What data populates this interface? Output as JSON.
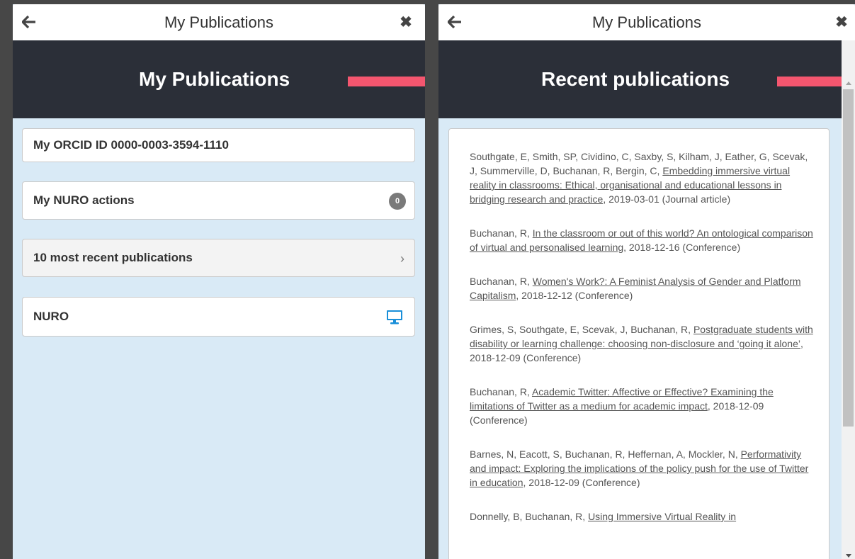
{
  "left_panel": {
    "window_title": "My Publications",
    "banner_title": "My Publications",
    "menu": {
      "orcid": "My ORCID ID 0000-0003-3594-1110",
      "actions": "My NURO actions",
      "actions_count": "0",
      "recent": "10 most recent publications",
      "nuro": "NURO"
    }
  },
  "right_panel": {
    "window_title": "My Publications",
    "banner_title": "Recent publications",
    "publications": [
      {
        "authors": "Southgate, E, Smith, SP, Cividino, C, Saxby, S, Kilham, J, Eather, G, Scevak, J, Summerville, D, Buchanan, R, Bergin, C, ",
        "title": "Embedding immersive virtual reality in classrooms: Ethical, organisational and educational lessons in bridging research and practice",
        "meta": ", 2019-03-01 (Journal article)"
      },
      {
        "authors": "Buchanan, R, ",
        "title": "In the classroom or out of this world? An ontological comparison of virtual and personalised learning",
        "meta": ", 2018-12-16 (Conference)"
      },
      {
        "authors": "Buchanan, R, ",
        "title": "Women's Work?: A Feminist Analysis of Gender and Platform Capitalism",
        "meta": ", 2018-12-12 (Conference)"
      },
      {
        "authors": "Grimes, S, Southgate, E, Scevak, J, Buchanan, R, ",
        "title": "Postgraduate students with disability or learning challenge: choosing non-disclosure and ‘going it alone’",
        "meta": ", 2018-12-09 (Conference)"
      },
      {
        "authors": "Buchanan, R, ",
        "title": "Academic Twitter: Affective or Effective? Examining the limitations of Twitter as a medium for academic impact",
        "meta": ", 2018-12-09 (Conference)"
      },
      {
        "authors": "Barnes, N, Eacott, S, Buchanan, R, Heffernan, A, Mockler, N, ",
        "title": "Performativity and impact: Exploring the implications of the policy push for the use of Twitter in education",
        "meta": ", 2018-12-09 (Conference)"
      },
      {
        "authors": "Donnelly, B, Buchanan, R, ",
        "title": "Using Immersive Virtual Reality in",
        "meta": ""
      }
    ]
  },
  "icons": {
    "back": "arrow-left-icon",
    "close": "close-icon",
    "badge": "count-badge",
    "chevron": "chevron-right-icon",
    "monitor": "desktop-monitor-icon"
  },
  "colors": {
    "banner_bg": "#2b2f38",
    "accent": "#f4566f",
    "panel_bg": "#d9eaf6",
    "monitor_icon": "#1a8fd9"
  }
}
